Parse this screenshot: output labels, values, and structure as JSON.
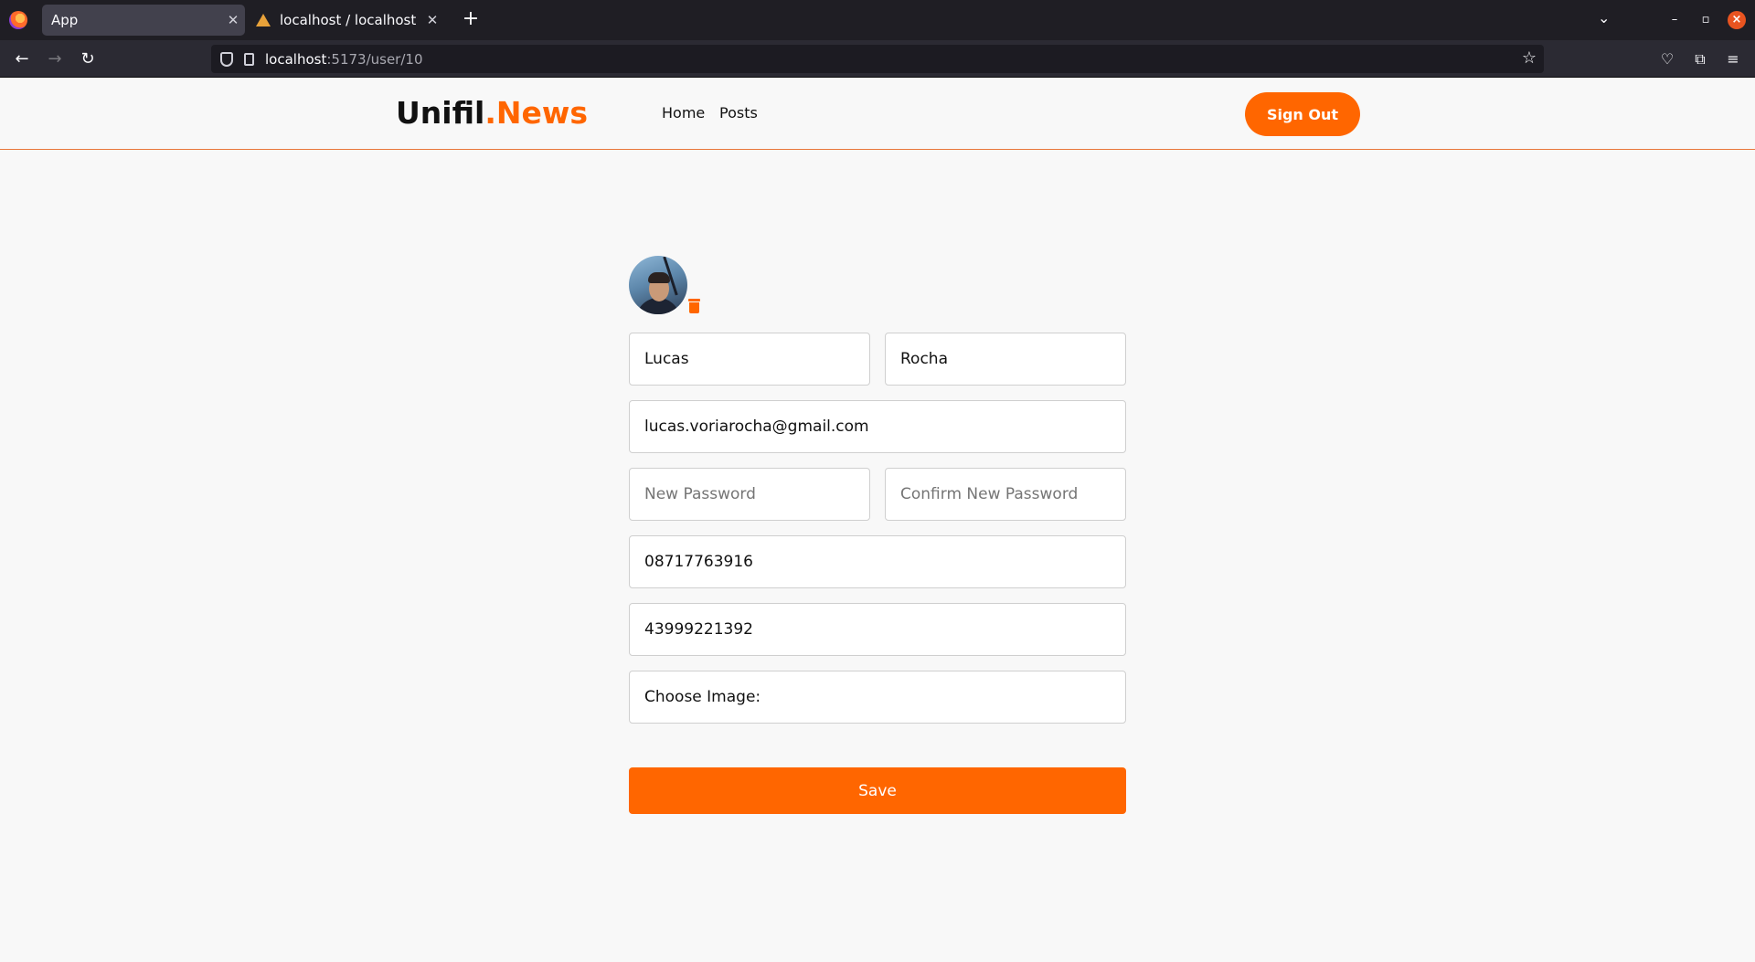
{
  "browser": {
    "tabs": [
      {
        "title": "App",
        "active": true
      },
      {
        "title": "localhost / localhost / cru",
        "active": false
      }
    ],
    "url_host": "localhost",
    "url_path": ":5173/user/10"
  },
  "header": {
    "brand_main": "Unifil",
    "brand_accent": ".News",
    "nav": [
      "Home",
      "Posts"
    ],
    "signout_label": "Sign Out"
  },
  "form": {
    "first_name": "Lucas",
    "last_name": "Rocha",
    "email": "lucas.voriarocha@gmail.com",
    "new_password_placeholder": "New Password",
    "confirm_password_placeholder": "Confirm New Password",
    "phone_1": "08717763916",
    "phone_2": "43999221392",
    "image_label": "Choose Image:",
    "save_label": "Save"
  },
  "colors": {
    "accent": "#ff6600",
    "background": "#f8f8f8"
  }
}
